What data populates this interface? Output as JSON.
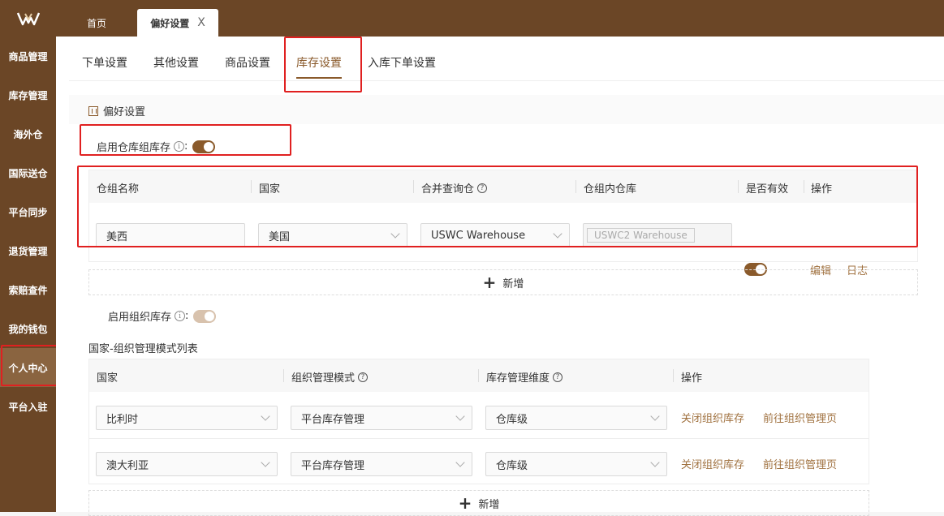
{
  "tabs": {
    "home": "首页",
    "active": "偏好设置",
    "close": "X"
  },
  "sidebar": {
    "items": [
      {
        "label": "商品管理"
      },
      {
        "label": "库存管理"
      },
      {
        "label": "海外仓"
      },
      {
        "label": "国际送仓"
      },
      {
        "label": "平台同步"
      },
      {
        "label": "退货管理"
      },
      {
        "label": "索赔查件"
      },
      {
        "label": "我的钱包"
      },
      {
        "label": "个人中心"
      },
      {
        "label": "平台入驻"
      }
    ],
    "active_index": 8
  },
  "subtabs": [
    "下单设置",
    "其他设置",
    "商品设置",
    "库存设置",
    "入库下单设置"
  ],
  "section": {
    "title": "偏好设置"
  },
  "warehouse_group": {
    "toggle_label": "启用仓库组库存",
    "toggle_suffix": ":",
    "toggle_on": true,
    "headers": [
      "仓组名称",
      "国家",
      "合并查询仓",
      "仓组内仓库",
      "是否有效",
      "操作"
    ],
    "row": {
      "name": "美西",
      "country": "美国",
      "merge_warehouse": "USWC Warehouse",
      "inner_warehouse": "USWC2 Warehouse",
      "valid": true,
      "actions": [
        "编辑",
        "日志"
      ]
    },
    "add_label": "新增"
  },
  "org": {
    "toggle_label": "启用组织库存",
    "toggle_suffix": ":",
    "toggle_on": true,
    "toggle_disabled": true,
    "list_title": "国家-组织管理模式列表",
    "headers": [
      "国家",
      "组织管理模式",
      "库存管理维度",
      "操作"
    ],
    "rows": [
      {
        "country": "比利时",
        "mode": "平台库存管理",
        "dimension": "仓库级",
        "actions": [
          "关闭组织库存",
          "前往组织管理页"
        ]
      },
      {
        "country": "澳大利亚",
        "mode": "平台库存管理",
        "dimension": "仓库级",
        "actions": [
          "关闭组织库存",
          "前往组织管理页"
        ]
      }
    ],
    "add_label": "新增"
  },
  "colors": {
    "brand": "#6b4626",
    "accent": "#8a5a2b",
    "link": "#a0713f",
    "highlight": "#e02020"
  },
  "icons": [
    "logo-icon",
    "info-icon",
    "question-icon",
    "chevron-down-icon",
    "plus-icon",
    "close-icon"
  ]
}
